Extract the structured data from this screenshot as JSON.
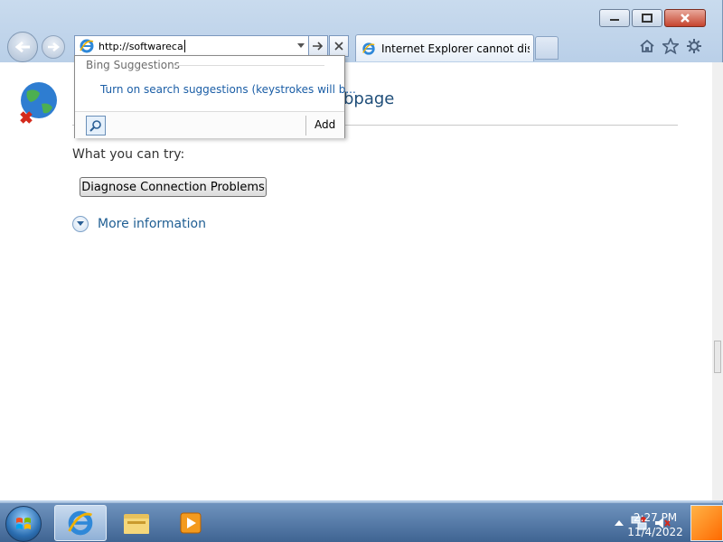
{
  "address_bar": {
    "value": "http://softwareca"
  },
  "tab": {
    "label": "Internet Explorer cannot displ..."
  },
  "page": {
    "title_suffix": "bpage",
    "try_label": "What you can try:",
    "diagnose_button": "Diagnose Connection Problems",
    "more_info": "More information"
  },
  "suggestions": {
    "header": "Bing Suggestions",
    "item": "Turn on search suggestions (keystrokes will b...",
    "add_label": "Add"
  },
  "taskbar": {
    "time": "2:27 PM",
    "date": "11/4/2022"
  },
  "icons": [
    "minimize-icon",
    "maximize-icon",
    "close-icon",
    "back-arrow-icon",
    "forward-arrow-icon",
    "ie-icon",
    "go-arrow-icon",
    "stop-icon",
    "home-icon",
    "favorites-star-icon",
    "tools-gear-icon",
    "globe-error-icon",
    "chevron-down-icon",
    "search-icon",
    "windows-logo-icon",
    "folder-icon",
    "media-player-icon",
    "tray-up-arrow-icon",
    "network-icon",
    "volume-muted-icon"
  ]
}
